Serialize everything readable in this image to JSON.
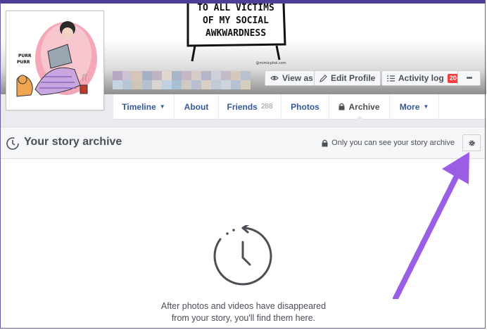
{
  "cover": {
    "art_text": [
      "TO ALL VICTIMS",
      "OF MY SOCIAL",
      "AWKWARDNESS"
    ],
    "art_signature": "@mimicphol.com"
  },
  "avatar": {
    "caption": [
      "PURR",
      "PURR"
    ]
  },
  "cover_buttons": {
    "view_as": "View as",
    "edit_profile": "Edit Profile",
    "activity_log": "Activity log",
    "activity_badge": "20+",
    "more": "•••"
  },
  "nav": {
    "timeline": "Timeline",
    "about": "About",
    "friends": "Friends",
    "friends_count": "288",
    "photos": "Photos",
    "archive": "Archive",
    "more": "More"
  },
  "archive": {
    "title": "Your story archive",
    "privacy_note": "Only you can see your story archive",
    "empty_line1": "After photos and videos have disappeared",
    "empty_line2": "from your story, you'll find them here."
  },
  "colors": {
    "link": "#365899",
    "badge": "#fa3e3e",
    "annotation_arrow": "#9b5de5",
    "frame": "#4b3f9a"
  },
  "icons": [
    "eye-icon",
    "pencil-icon",
    "list-icon",
    "lock-icon",
    "gear-icon",
    "clock-history-icon",
    "arrow-annotation"
  ]
}
